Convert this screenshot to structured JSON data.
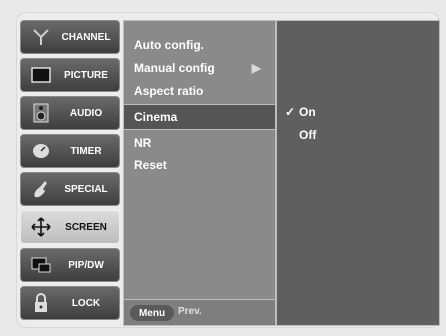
{
  "sidebar": {
    "items": [
      {
        "label": "CHANNEL",
        "icon": "antenna-icon"
      },
      {
        "label": "PICTURE",
        "icon": "tv-screen-icon"
      },
      {
        "label": "AUDIO",
        "icon": "speaker-icon"
      },
      {
        "label": "TIMER",
        "icon": "clock-icon"
      },
      {
        "label": "SPECIAL",
        "icon": "hand-icon"
      },
      {
        "label": "SCREEN",
        "icon": "move-arrows-icon"
      },
      {
        "label": "PIP/DW",
        "icon": "pip-window-icon"
      },
      {
        "label": "LOCK",
        "icon": "padlock-icon"
      }
    ]
  },
  "submenu": {
    "items": [
      {
        "label": "Auto config.",
        "has_arrow": false
      },
      {
        "label": "Manual config",
        "has_arrow": true
      },
      {
        "label": "Aspect ratio",
        "has_arrow": false
      },
      {
        "label": "Cinema",
        "has_arrow": false
      },
      {
        "label": "NR",
        "has_arrow": false
      },
      {
        "label": "Reset",
        "has_arrow": false
      }
    ],
    "arrow": "▶",
    "bottom": {
      "menu": "Menu",
      "prev": "Prev."
    }
  },
  "options": {
    "items": [
      {
        "label": "On",
        "checked": true
      },
      {
        "label": "Off",
        "checked": false
      }
    ],
    "check_mark": "✓"
  },
  "colors": {
    "active_sidebar": "#d2d2d2",
    "submenu_bg": "#8a8a8a",
    "options_bg": "#5f5f5f"
  }
}
